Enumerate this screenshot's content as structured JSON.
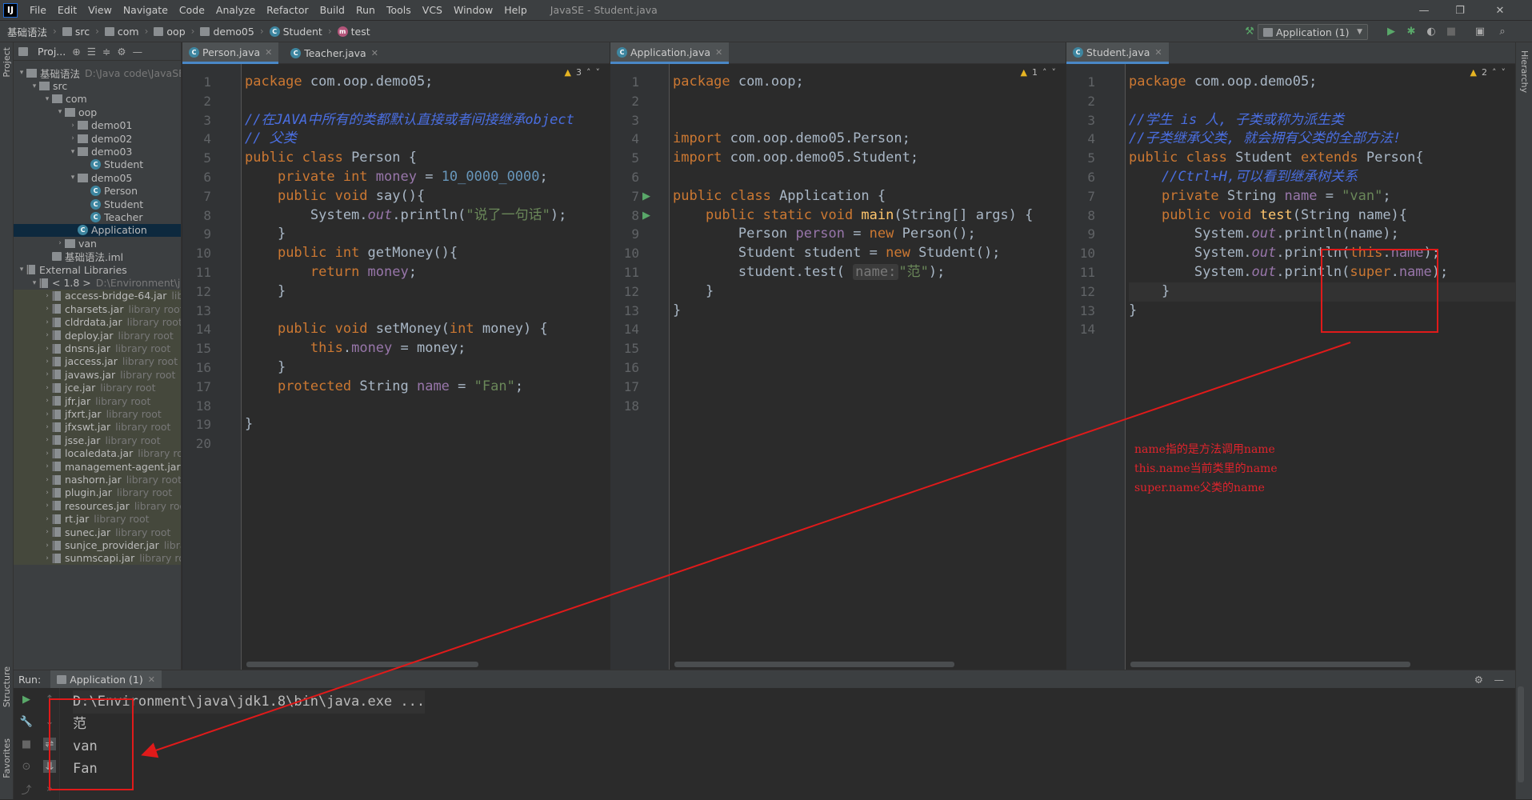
{
  "menubar": {
    "items": [
      "File",
      "Edit",
      "View",
      "Navigate",
      "Code",
      "Analyze",
      "Refactor",
      "Build",
      "Run",
      "Tools",
      "VCS",
      "Window",
      "Help"
    ],
    "title": "JavaSE - Student.java",
    "logo": "IJ"
  },
  "navbar": {
    "crumbs": [
      "基础语法",
      "src",
      "com",
      "oop",
      "demo05",
      "Student",
      "test"
    ],
    "run_config": "Application (1)"
  },
  "left_tool": {
    "project": "Project",
    "structure": "Structure",
    "favorites": "Favorites"
  },
  "right_tool": {
    "hierarchy": "Hierarchy"
  },
  "project": {
    "header": "Proj...",
    "tree": [
      {
        "label": "基础语法",
        "hint": "D:\\Java code\\JavaSE",
        "indent": 0,
        "open": true,
        "kind": "module"
      },
      {
        "label": "src",
        "hint": "",
        "indent": 1,
        "open": true,
        "kind": "folder"
      },
      {
        "label": "com",
        "hint": "",
        "indent": 2,
        "open": true,
        "kind": "folder"
      },
      {
        "label": "oop",
        "hint": "",
        "indent": 3,
        "open": true,
        "kind": "folder"
      },
      {
        "label": "demo01",
        "hint": "",
        "indent": 4,
        "open": false,
        "kind": "folder"
      },
      {
        "label": "demo02",
        "hint": "",
        "indent": 4,
        "open": false,
        "kind": "folder"
      },
      {
        "label": "demo03",
        "hint": "",
        "indent": 4,
        "open": true,
        "kind": "folder"
      },
      {
        "label": "Student",
        "hint": "",
        "indent": 5,
        "open": null,
        "kind": "class"
      },
      {
        "label": "demo05",
        "hint": "",
        "indent": 4,
        "open": true,
        "kind": "folder"
      },
      {
        "label": "Person",
        "hint": "",
        "indent": 5,
        "open": null,
        "kind": "class"
      },
      {
        "label": "Student",
        "hint": "",
        "indent": 5,
        "open": null,
        "kind": "class"
      },
      {
        "label": "Teacher",
        "hint": "",
        "indent": 5,
        "open": null,
        "kind": "class"
      },
      {
        "label": "Application",
        "hint": "",
        "indent": 4,
        "open": null,
        "kind": "class",
        "selected": true
      },
      {
        "label": "van",
        "hint": "",
        "indent": 3,
        "open": false,
        "kind": "folder"
      },
      {
        "label": "基础语法.iml",
        "hint": "",
        "indent": 2,
        "open": null,
        "kind": "file"
      },
      {
        "label": "External Libraries",
        "hint": "",
        "indent": 0,
        "open": true,
        "kind": "lib"
      },
      {
        "label": "< 1.8 >",
        "hint": "D:\\Environment\\java",
        "indent": 1,
        "open": true,
        "kind": "sdk"
      },
      {
        "label": "access-bridge-64.jar",
        "hint": "library root",
        "indent": 2,
        "open": false,
        "kind": "jar"
      },
      {
        "label": "charsets.jar",
        "hint": "library root",
        "indent": 2,
        "open": false,
        "kind": "jar"
      },
      {
        "label": "cldrdata.jar",
        "hint": "library root",
        "indent": 2,
        "open": false,
        "kind": "jar"
      },
      {
        "label": "deploy.jar",
        "hint": "library root",
        "indent": 2,
        "open": false,
        "kind": "jar"
      },
      {
        "label": "dnsns.jar",
        "hint": "library root",
        "indent": 2,
        "open": false,
        "kind": "jar"
      },
      {
        "label": "jaccess.jar",
        "hint": "library root",
        "indent": 2,
        "open": false,
        "kind": "jar"
      },
      {
        "label": "javaws.jar",
        "hint": "library root",
        "indent": 2,
        "open": false,
        "kind": "jar"
      },
      {
        "label": "jce.jar",
        "hint": "library root",
        "indent": 2,
        "open": false,
        "kind": "jar"
      },
      {
        "label": "jfr.jar",
        "hint": "library root",
        "indent": 2,
        "open": false,
        "kind": "jar"
      },
      {
        "label": "jfxrt.jar",
        "hint": "library root",
        "indent": 2,
        "open": false,
        "kind": "jar"
      },
      {
        "label": "jfxswt.jar",
        "hint": "library root",
        "indent": 2,
        "open": false,
        "kind": "jar"
      },
      {
        "label": "jsse.jar",
        "hint": "library root",
        "indent": 2,
        "open": false,
        "kind": "jar"
      },
      {
        "label": "localedata.jar",
        "hint": "library root",
        "indent": 2,
        "open": false,
        "kind": "jar"
      },
      {
        "label": "management-agent.jar",
        "hint": "",
        "indent": 2,
        "open": false,
        "kind": "jar"
      },
      {
        "label": "nashorn.jar",
        "hint": "library root",
        "indent": 2,
        "open": false,
        "kind": "jar"
      },
      {
        "label": "plugin.jar",
        "hint": "library root",
        "indent": 2,
        "open": false,
        "kind": "jar"
      },
      {
        "label": "resources.jar",
        "hint": "library root",
        "indent": 2,
        "open": false,
        "kind": "jar"
      },
      {
        "label": "rt.jar",
        "hint": "library root",
        "indent": 2,
        "open": false,
        "kind": "jar"
      },
      {
        "label": "sunec.jar",
        "hint": "library root",
        "indent": 2,
        "open": false,
        "kind": "jar"
      },
      {
        "label": "sunjce_provider.jar",
        "hint": "library root",
        "indent": 2,
        "open": false,
        "kind": "jar"
      },
      {
        "label": "sunmscapi.jar",
        "hint": "library root",
        "indent": 2,
        "open": false,
        "kind": "jar"
      }
    ]
  },
  "editors": [
    {
      "tabs": [
        "Person.java",
        "Teacher.java"
      ],
      "active_tab": 0,
      "warning_count": "3",
      "lines": [
        [
          [
            "kw",
            "package "
          ],
          [
            "",
            "com.oop.demo05;"
          ]
        ],
        [],
        [
          [
            "cmtb",
            "//在JAVA中所有的类都默认直接或者间接继承object"
          ]
        ],
        [
          [
            "cmtb",
            "// 父类"
          ]
        ],
        [
          [
            "kw",
            "public class "
          ],
          [
            "",
            "Person {"
          ]
        ],
        [
          [
            "",
            "    "
          ],
          [
            "kw",
            "private int "
          ],
          [
            "fld",
            "money"
          ],
          [
            "",
            " = "
          ],
          [
            "num",
            "10_0000_0000"
          ],
          [
            "",
            ";"
          ]
        ],
        [
          [
            "",
            "    "
          ],
          [
            "kw",
            "public void "
          ],
          [
            "",
            "say(){"
          ]
        ],
        [
          [
            "",
            "        System."
          ],
          [
            "ital",
            "out"
          ],
          [
            "",
            ".println("
          ],
          [
            "str",
            "\"说了一句话\""
          ],
          [
            "",
            ");"
          ]
        ],
        [
          [
            "",
            "    }"
          ]
        ],
        [
          [
            "",
            "    "
          ],
          [
            "kw",
            "public int "
          ],
          [
            "",
            "getMoney(){"
          ]
        ],
        [
          [
            "",
            "        "
          ],
          [
            "kw",
            "return "
          ],
          [
            "fld",
            "money"
          ],
          [
            "",
            ";"
          ]
        ],
        [
          [
            "",
            "    }"
          ]
        ],
        [],
        [
          [
            "",
            "    "
          ],
          [
            "kw",
            "public void "
          ],
          [
            "",
            "setMoney("
          ],
          [
            "kw",
            "int "
          ],
          [
            "",
            "money) {"
          ]
        ],
        [
          [
            "",
            "        "
          ],
          [
            "kw",
            "this"
          ],
          [
            "",
            "."
          ],
          [
            "fld",
            "money"
          ],
          [
            "",
            " = money;"
          ]
        ],
        [
          [
            "",
            "    }"
          ]
        ],
        [
          [
            "",
            "    "
          ],
          [
            "kw",
            "protected "
          ],
          [
            "",
            "String "
          ],
          [
            "fld",
            "name"
          ],
          [
            "",
            " = "
          ],
          [
            "str",
            "\"Fan\""
          ],
          [
            "",
            ";"
          ]
        ],
        [],
        [
          [
            "",
            "}"
          ]
        ],
        []
      ]
    },
    {
      "tabs": [
        "Application.java"
      ],
      "active_tab": 0,
      "warning_count": "1",
      "lines": [
        [
          [
            "kw",
            "package "
          ],
          [
            "",
            "com.oop;"
          ]
        ],
        [],
        [],
        [
          [
            "kw",
            "import "
          ],
          [
            "",
            "com.oop.demo05.Person;"
          ]
        ],
        [
          [
            "kw",
            "import "
          ],
          [
            "",
            "com.oop.demo05.Student;"
          ]
        ],
        [],
        [
          [
            "kw",
            "public class "
          ],
          [
            "",
            "Application {"
          ]
        ],
        [
          [
            "",
            "    "
          ],
          [
            "kw",
            "public static void "
          ],
          [
            "fn",
            "main"
          ],
          [
            "",
            "(String[] args) {"
          ]
        ],
        [
          [
            "",
            "        Person "
          ],
          [
            "fld",
            "person"
          ],
          [
            "",
            " = "
          ],
          [
            "kw",
            "new "
          ],
          [
            "",
            "Person();"
          ]
        ],
        [
          [
            "",
            "        Student student = "
          ],
          [
            "kw",
            "new "
          ],
          [
            "",
            "Student();"
          ]
        ],
        [
          [
            "",
            "        student.test( "
          ],
          [
            "hint2",
            "name:"
          ],
          [
            "str",
            "\"范\""
          ],
          [
            "",
            ");"
          ]
        ],
        [
          [
            "",
            "    }"
          ]
        ],
        [
          [
            "",
            "}"
          ]
        ],
        [],
        [],
        [],
        [],
        []
      ]
    },
    {
      "tabs": [
        "Student.java"
      ],
      "active_tab": 0,
      "warning_count": "2",
      "lines": [
        [
          [
            "kw",
            "package "
          ],
          [
            "",
            "com.oop.demo05;"
          ]
        ],
        [],
        [
          [
            "cmtb",
            "//学生 is 人, 子类或称为派生类"
          ]
        ],
        [
          [
            "cmtb",
            "//子类继承父类, 就会拥有父类的全部方法!"
          ]
        ],
        [
          [
            "kw",
            "public class "
          ],
          [
            "",
            "Student "
          ],
          [
            "kw",
            "extends "
          ],
          [
            "",
            "Person{"
          ]
        ],
        [
          [
            "cmtb",
            "    //Ctrl+H,可以看到继承树关系"
          ]
        ],
        [
          [
            "",
            "    "
          ],
          [
            "kw",
            "private "
          ],
          [
            "",
            "String "
          ],
          [
            "fld",
            "name"
          ],
          [
            "",
            " = "
          ],
          [
            "str",
            "\"van\""
          ],
          [
            "",
            ";"
          ]
        ],
        [
          [
            "",
            "    "
          ],
          [
            "kw",
            "public void "
          ],
          [
            "fn",
            "test"
          ],
          [
            "",
            "(String name){"
          ]
        ],
        [
          [
            "",
            "        System."
          ],
          [
            "ital",
            "out"
          ],
          [
            "",
            ".println(name);"
          ]
        ],
        [
          [
            "",
            "        System."
          ],
          [
            "ital",
            "out"
          ],
          [
            "",
            ".println("
          ],
          [
            "kw",
            "this"
          ],
          [
            "",
            "."
          ],
          [
            "fld",
            "name"
          ],
          [
            "",
            ");"
          ]
        ],
        [
          [
            "",
            "        System."
          ],
          [
            "ital",
            "out"
          ],
          [
            "",
            ".println("
          ],
          [
            "kw",
            "super"
          ],
          [
            "",
            "."
          ],
          [
            "fld",
            "name"
          ],
          [
            "",
            ");"
          ]
        ],
        [
          [
            "",
            "    }"
          ]
        ],
        [
          [
            "",
            "}"
          ]
        ],
        []
      ]
    }
  ],
  "annotation": {
    "lines": [
      "name指的是方法调用name",
      "this.name当前类里的name",
      "super.name父类的name"
    ],
    "color": "#e0242c"
  },
  "run": {
    "label": "Run:",
    "tab": "Application (1)",
    "output": [
      "D:\\Environment\\java\\jdk1.8\\bin\\java.exe ...",
      "范",
      "van",
      "Fan"
    ]
  }
}
